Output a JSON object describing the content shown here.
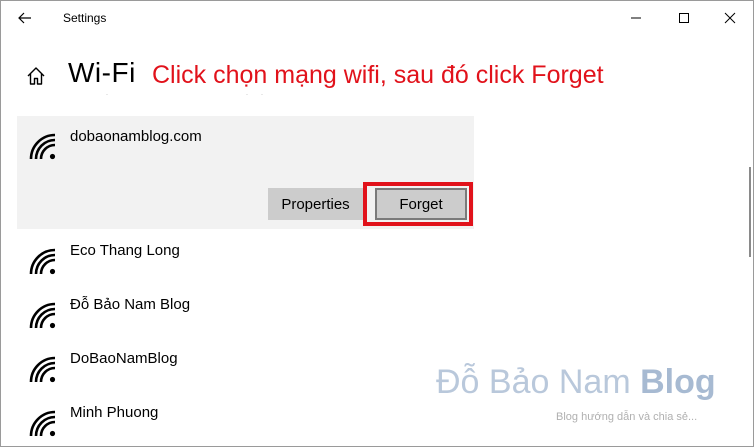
{
  "window": {
    "title": "Settings"
  },
  "page": {
    "title": "Wi-Fi",
    "annotation": "Click chọn mạng wifi, sau đó click Forget"
  },
  "icons": {
    "back": "back-arrow-icon",
    "home": "home-icon",
    "minimize": "minimize-icon",
    "maximize": "maximize-icon",
    "close": "close-icon",
    "wifi": "wifi-signal-icon"
  },
  "selected_network": {
    "name": "dobaonamblog.com",
    "properties_label": "Properties",
    "forget_label": "Forget"
  },
  "networks": [
    {
      "name": "Eco Thang Long"
    },
    {
      "name": "Đỗ Bảo Nam Blog"
    },
    {
      "name": "DoBaoNamBlog"
    },
    {
      "name": "Minh Phuong"
    }
  ],
  "watermark": {
    "brand_part1": "Đỗ Bảo Nam ",
    "brand_part2": "Blog",
    "tagline": "Blog hướng dẫn và chia sẻ..."
  },
  "colors": {
    "annotation": "#e1121b",
    "selected_bg": "#f2f2f2",
    "button_bg": "#cccccc"
  }
}
